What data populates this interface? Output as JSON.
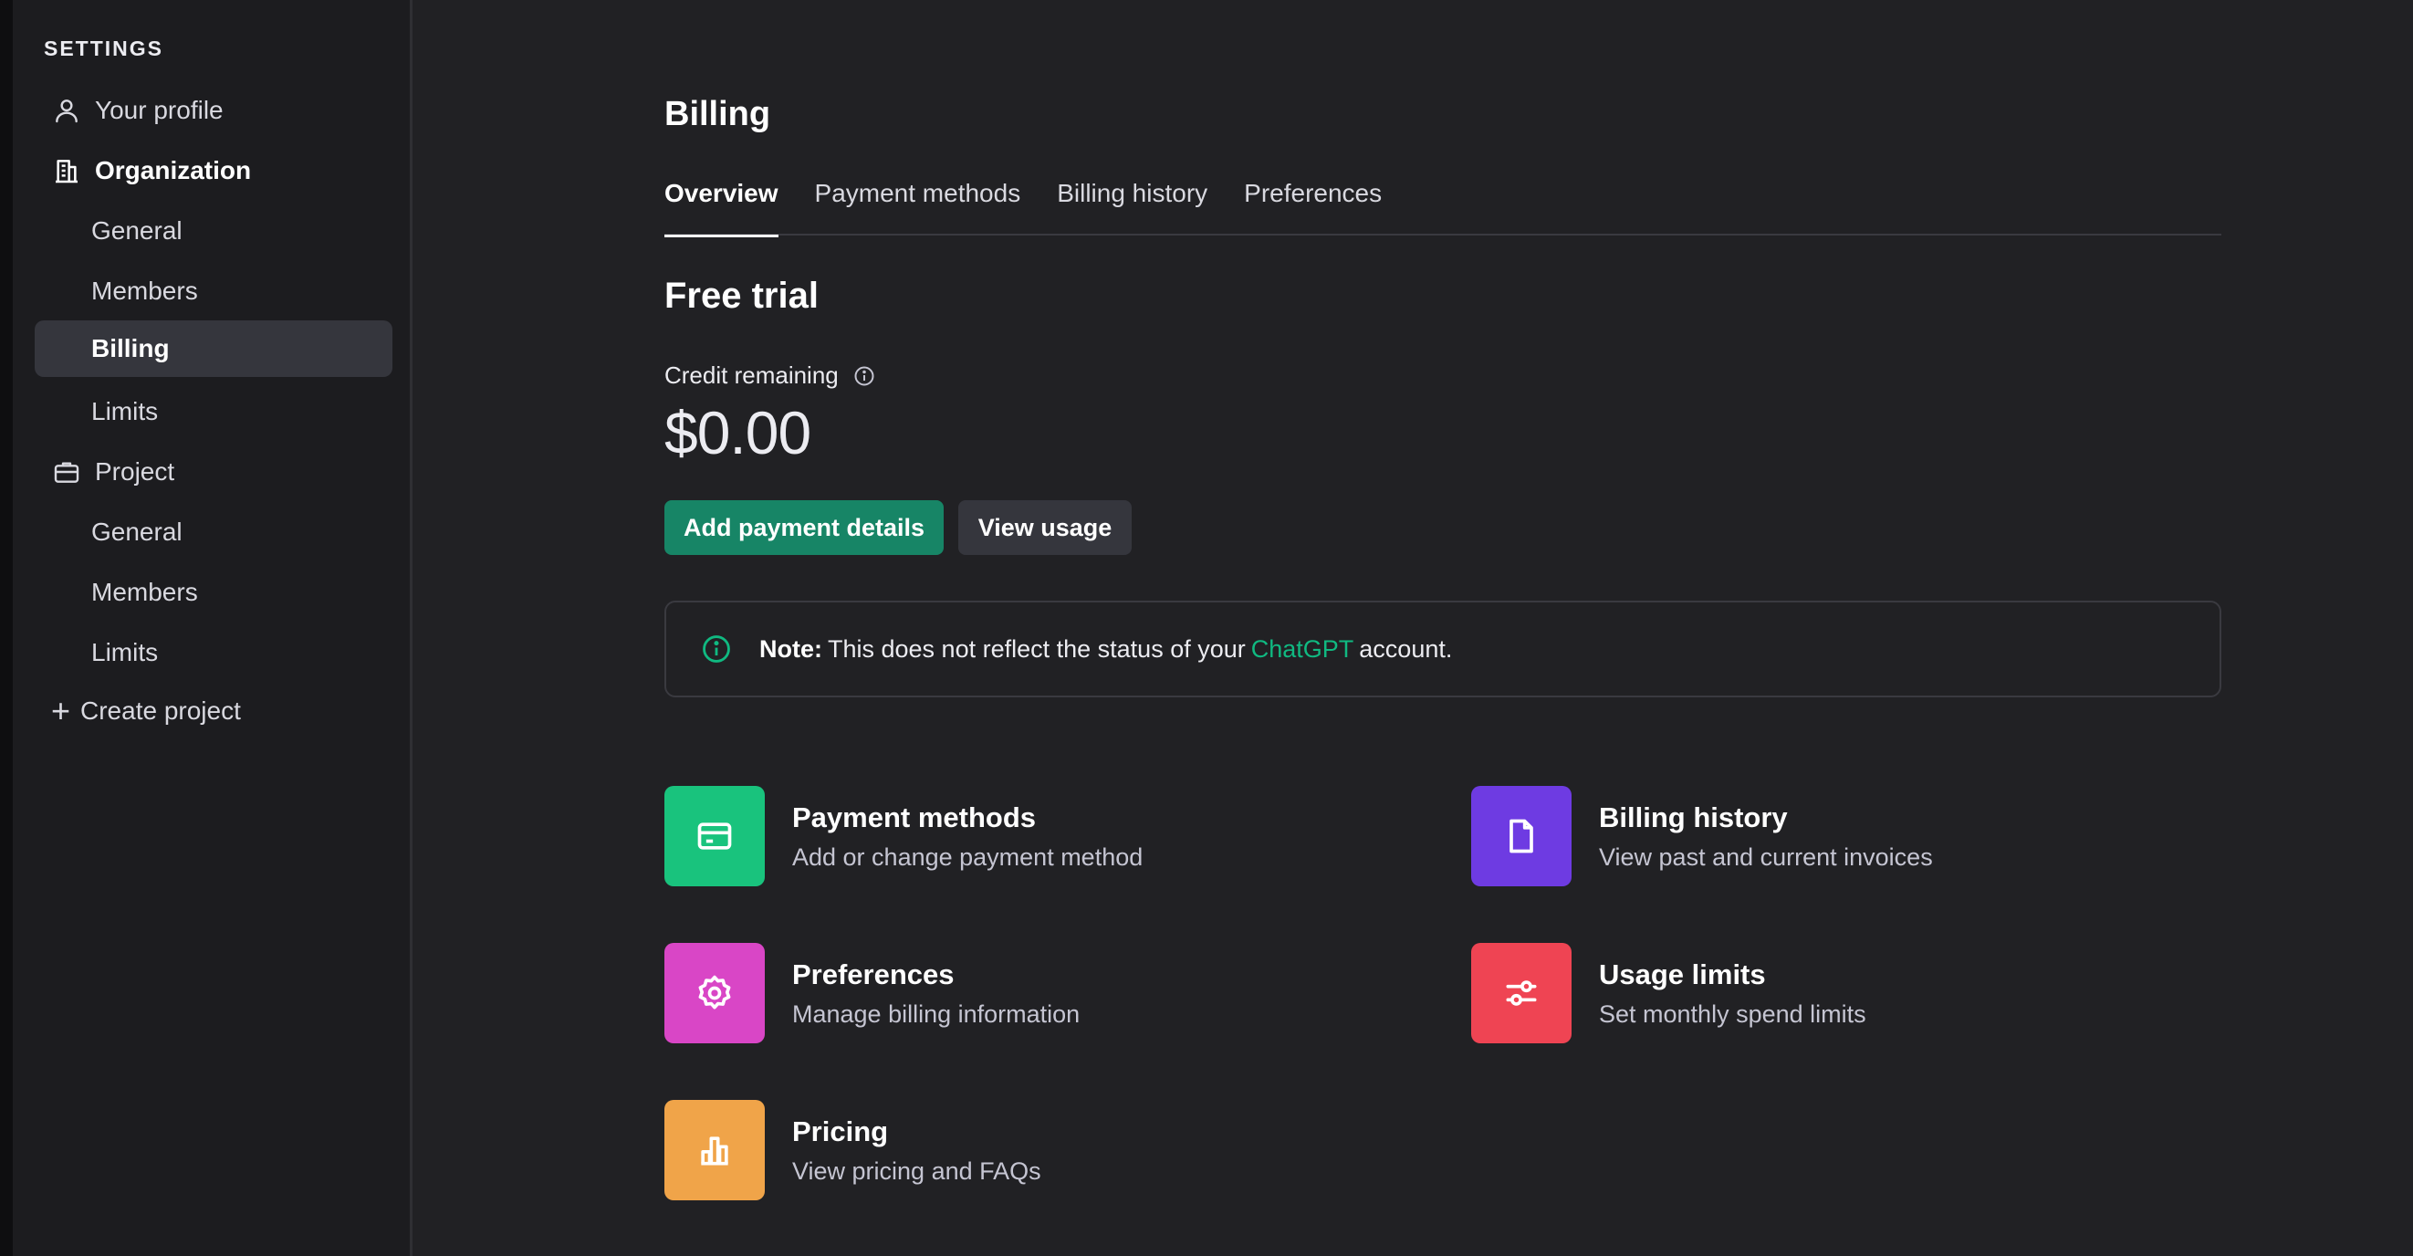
{
  "sidebar": {
    "heading": "SETTINGS",
    "items": [
      {
        "label": "Your profile"
      },
      {
        "label": "Organization"
      },
      {
        "label": "General"
      },
      {
        "label": "Members"
      },
      {
        "label": "Billing"
      },
      {
        "label": "Limits"
      },
      {
        "label": "Project"
      },
      {
        "label": "General"
      },
      {
        "label": "Members"
      },
      {
        "label": "Limits"
      },
      {
        "label": "Create project"
      }
    ]
  },
  "main": {
    "title": "Billing",
    "tabs": [
      {
        "label": "Overview"
      },
      {
        "label": "Payment methods"
      },
      {
        "label": "Billing history"
      },
      {
        "label": "Preferences"
      }
    ],
    "section_title": "Free trial",
    "credit_label": "Credit remaining",
    "credit_amount": "$0.00",
    "buttons": {
      "add_payment": "Add payment details",
      "view_usage": "View usage"
    },
    "note": {
      "strong": "Note:",
      "text_before": "This does not reflect the status of your",
      "link": "ChatGPT",
      "text_after": "account."
    },
    "cards": [
      {
        "title": "Payment methods",
        "desc": "Add or change payment method",
        "icon": "credit-card-icon",
        "color": "#19c37d"
      },
      {
        "title": "Billing history",
        "desc": "View past and current invoices",
        "icon": "document-icon",
        "color": "#6e3be2"
      },
      {
        "title": "Preferences",
        "desc": "Manage billing information",
        "icon": "gear-icon",
        "color": "#d946c6"
      },
      {
        "title": "Usage limits",
        "desc": "Set monthly spend limits",
        "icon": "sliders-icon",
        "color": "#ef4453"
      },
      {
        "title": "Pricing",
        "desc": "View pricing and FAQs",
        "icon": "bar-chart-icon",
        "color": "#f0a449"
      }
    ]
  },
  "colors": {
    "accent": "#178566",
    "link": "#10b981",
    "background": "#212124",
    "sidebar": "#1c1c1f"
  }
}
